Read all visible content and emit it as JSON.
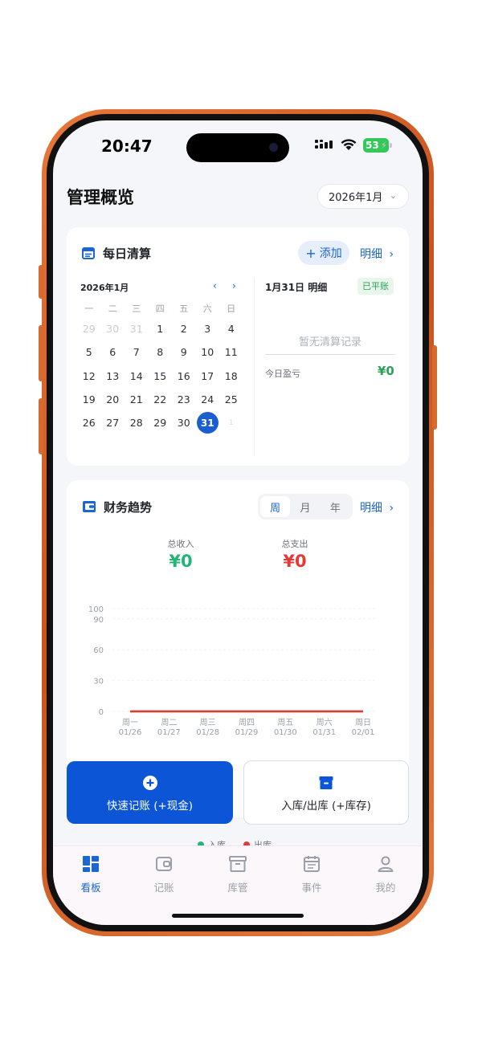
{
  "status_bar": {
    "time": "20:47",
    "battery": "53"
  },
  "header": {
    "title": "管理概览",
    "month_selector": "2026年1月"
  },
  "daily_settlement": {
    "title": "每日清算",
    "add_button": "添加",
    "detail_link": "明细",
    "calendar": {
      "month_label": "2026年1月",
      "weekdays": [
        "一",
        "二",
        "三",
        "四",
        "五",
        "六",
        "日"
      ],
      "days": [
        [
          "29",
          "30",
          "31",
          "1",
          "2",
          "3",
          "4"
        ],
        [
          "5",
          "6",
          "7",
          "8",
          "9",
          "10",
          "11"
        ],
        [
          "12",
          "13",
          "14",
          "15",
          "16",
          "17",
          "18"
        ],
        [
          "19",
          "20",
          "21",
          "22",
          "23",
          "24",
          "25"
        ],
        [
          "26",
          "27",
          "28",
          "29",
          "30",
          "31",
          "1"
        ]
      ],
      "selected_day": "31"
    },
    "detail": {
      "date_title": "1月31日 明细",
      "status_badge": "已平账",
      "empty_text": "暂无清算记录",
      "profit_label": "今日盈亏",
      "profit_value": "¥0"
    }
  },
  "finance_trend": {
    "title": "财务趋势",
    "periods": [
      "周",
      "月",
      "年"
    ],
    "active_period": "周",
    "detail_link": "明细",
    "income_label": "总收入",
    "income_value": "¥0",
    "expense_label": "总支出",
    "expense_value": "¥0",
    "income_color": "#22b573",
    "expense_color": "#e53935"
  },
  "chart_data": {
    "type": "line",
    "x": [
      "周一\n01/26",
      "周二\n01/27",
      "周三\n01/28",
      "周四\n01/29",
      "周五\n01/30",
      "周六\n01/31",
      "周日\n02/01"
    ],
    "x_day": [
      "周一",
      "周二",
      "周三",
      "周四",
      "周五",
      "周六",
      "周日"
    ],
    "x_date": [
      "01/26",
      "01/27",
      "01/28",
      "01/29",
      "01/30",
      "01/31",
      "02/01"
    ],
    "y_ticks": [
      "100",
      "90",
      "60",
      "30",
      "0"
    ],
    "y_tick_values": [
      100,
      90,
      60,
      30,
      0
    ],
    "ylim": [
      0,
      100
    ],
    "series": [
      {
        "name": "入库",
        "color": "#22b573",
        "values": [
          0,
          0,
          0,
          0,
          0,
          0,
          0
        ]
      },
      {
        "name": "出库",
        "color": "#e53935",
        "values": [
          0,
          0,
          0,
          0,
          0,
          0,
          0
        ]
      }
    ],
    "grid": true,
    "legend": "bottom"
  },
  "actions": {
    "quick_entry": "快速记账 (+现金)",
    "stock_entry": "入库/出库 (+库存)"
  },
  "tabbar": {
    "items": [
      {
        "label": "看板",
        "icon": "dashboard-icon",
        "active": true
      },
      {
        "label": "记账",
        "icon": "wallet-icon",
        "active": false
      },
      {
        "label": "库管",
        "icon": "archive-icon",
        "active": false
      },
      {
        "label": "事件",
        "icon": "calendar-icon",
        "active": false
      },
      {
        "label": "我的",
        "icon": "person-icon",
        "active": false
      }
    ]
  }
}
